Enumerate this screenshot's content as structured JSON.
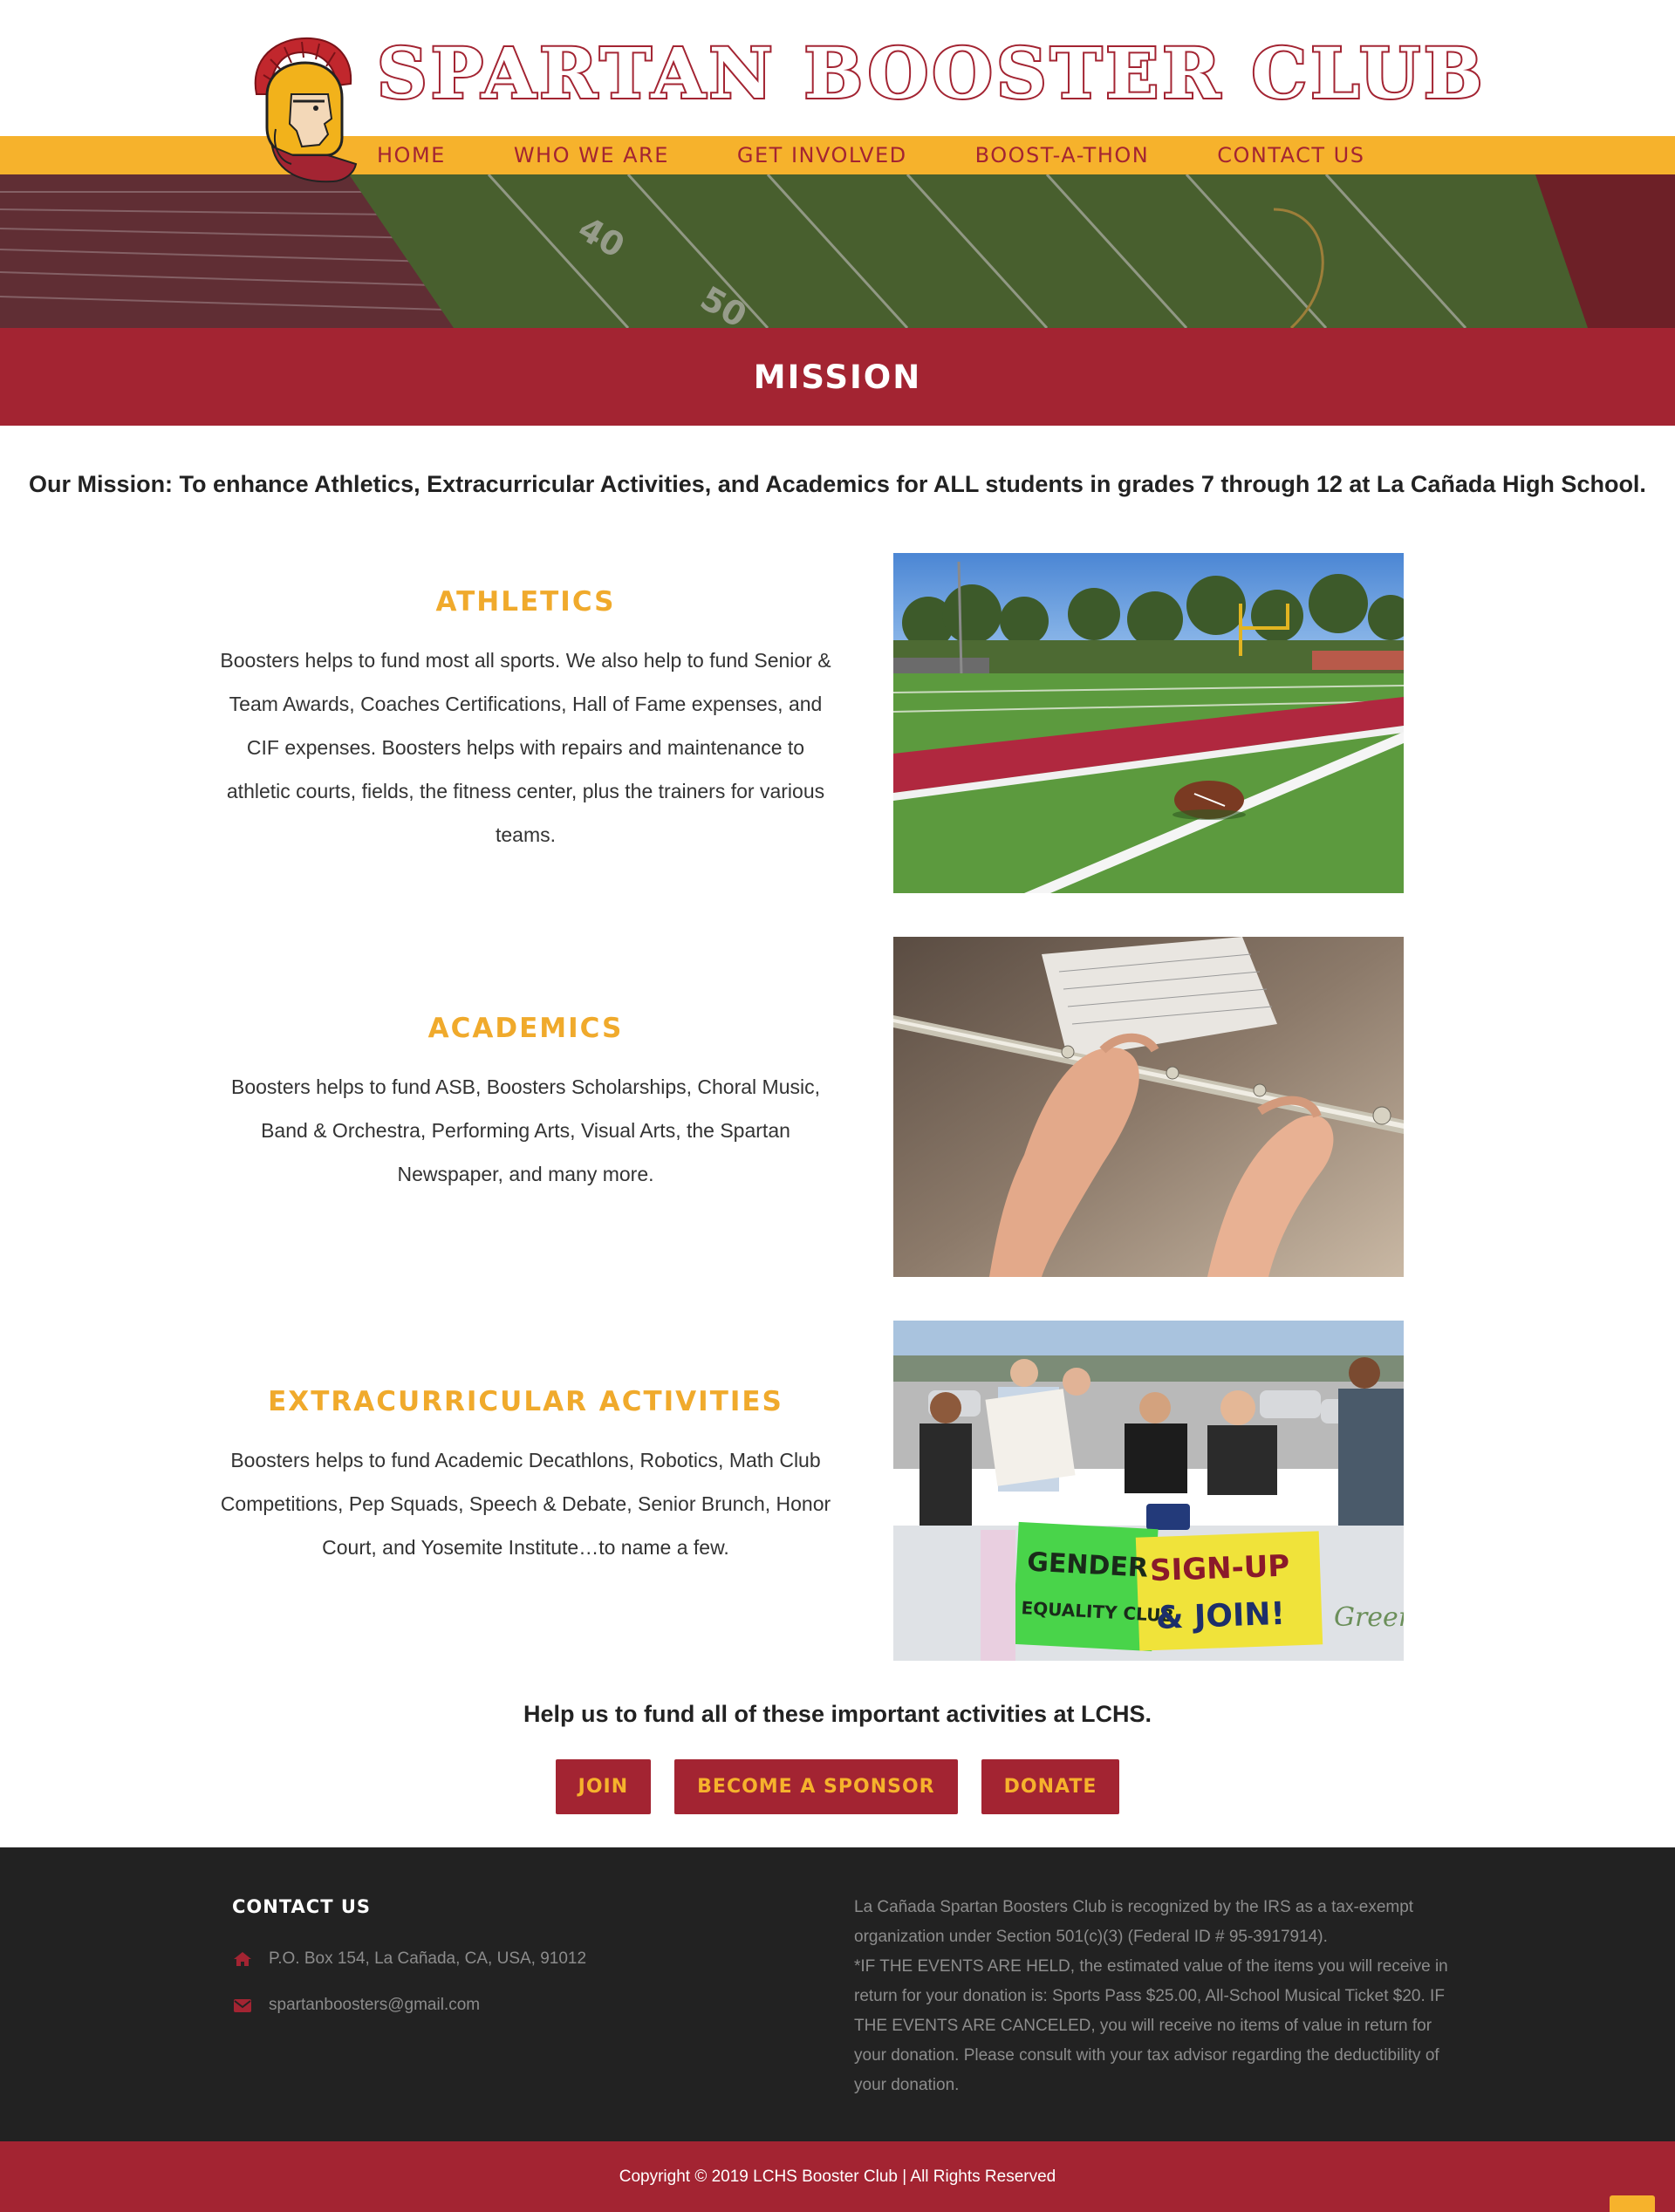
{
  "site": {
    "brand_title": "SPARTAN BOOSTER CLUB",
    "accent_red": "#a32432",
    "accent_gold": "#f6b22c",
    "logo_icon": "spartan-helmet-logo"
  },
  "nav": {
    "items": [
      {
        "label": "HOME"
      },
      {
        "label": "WHO WE ARE"
      },
      {
        "label": "GET INVOLVED"
      },
      {
        "label": "BOOST-A-THON"
      },
      {
        "label": "CONTACT US"
      }
    ]
  },
  "banner": {
    "yard_numbers": [
      "40",
      "50"
    ]
  },
  "mission": {
    "heading": "MISSION",
    "statement": "Our Mission: To enhance Athletics, Extracurricular Activities, and Academics for ALL students in grades 7 through 12 at La Cañada High School."
  },
  "sections": [
    {
      "title": "ATHLETICS",
      "body": "Boosters helps to fund most all sports. We also help to fund Senior & Team Awards, Coaches Certifications, Hall of Fame expenses, and CIF expenses. Boosters helps with repairs and maintenance to athletic courts, fields, the fitness center, plus the trainers for various teams.",
      "image": "football-field-photo"
    },
    {
      "title": "ACADEMICS",
      "body": "Boosters helps to fund ASB, Boosters Scholarships, Choral Music, Band & Orchestra, Performing Arts, Visual Arts, the Spartan Newspaper, and many more.",
      "image": "flute-player-photo"
    },
    {
      "title": "EXTRACURRICULAR ACTIVITIES",
      "body": "Boosters helps to fund Academic Decathlons, Robotics, Math Club Competitions, Pep Squads, Speech & Debate, Senior Brunch, Honor Court, and Yosemite Institute…to name a few.",
      "image": "club-fair-photo",
      "sign_left": [
        "GENDER",
        "EQUALITY CLUB"
      ],
      "sign_right": [
        "SIGN-UP",
        "& JOIN!"
      ],
      "sign_green": "Green"
    }
  ],
  "cta": {
    "text": "Help us to fund all of these important activities at LCHS.",
    "buttons": [
      {
        "label": "JOIN"
      },
      {
        "label": "BECOME A SPONSOR"
      },
      {
        "label": "DONATE"
      }
    ]
  },
  "footer": {
    "contact_heading": "CONTACT US",
    "address_icon": "home-icon",
    "address": "P.O. Box 154, La Cañada, CA, USA, 91012",
    "email_icon": "envelope-icon",
    "email": "spartanboosters@gmail.com",
    "legal_1": "La Cañada Spartan Boosters Club is recognized by the IRS as a tax-exempt organization under Section 501(c)(3) (Federal ID # 95-3917914).",
    "legal_2": "*IF THE EVENTS ARE HELD, the estimated value of the items you will receive in return for your donation is: Sports Pass $25.00, All-School Musical Ticket $20.  IF THE EVENTS ARE CANCELED, you will receive no items of value in return for your donation.  Please consult with your tax advisor regarding the deductibility of your donation."
  },
  "copyright": "Copyright © 2019 LCHS Booster Club | All Rights Reserved"
}
